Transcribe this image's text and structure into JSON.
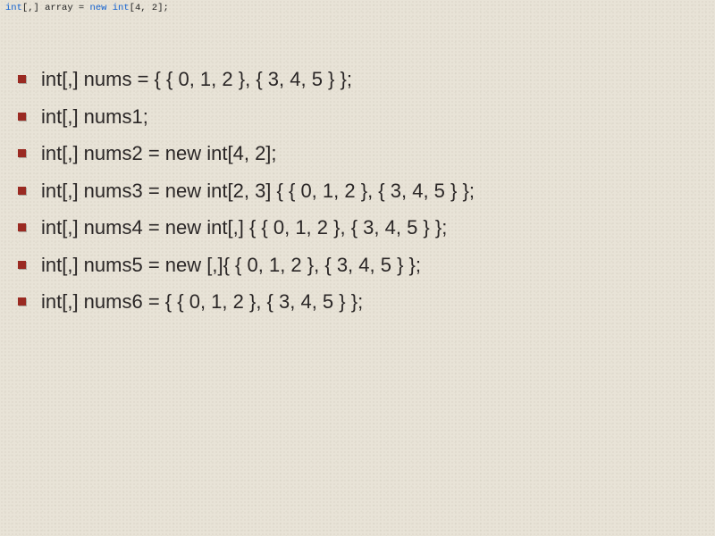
{
  "header": {
    "tokens": [
      {
        "t": "int",
        "cls": "kw-type"
      },
      {
        "t": "[,] array = ",
        "cls": "plain"
      },
      {
        "t": "new ",
        "cls": "kw-new"
      },
      {
        "t": "int",
        "cls": "kw-type"
      },
      {
        "t": "[",
        "cls": "plain"
      },
      {
        "t": "4",
        "cls": "num"
      },
      {
        "t": ", ",
        "cls": "plain"
      },
      {
        "t": "2",
        "cls": "num"
      },
      {
        "t": "];",
        "cls": "plain"
      }
    ]
  },
  "bullets": [
    "int[,] nums = { { 0, 1, 2 }, { 3, 4, 5 } };",
    "int[,] nums1;",
    "int[,] nums2 = new int[4, 2];",
    "int[,] nums3 = new int[2, 3] { { 0, 1, 2 }, { 3, 4, 5 } };",
    "int[,] nums4 = new int[,] { { 0, 1, 2 }, { 3, 4, 5 } };",
    "int[,] nums5 = new [,]{ { 0, 1, 2 }, { 3, 4, 5 } };",
    "int[,] nums6 = { { 0, 1, 2 }, { 3, 4, 5 } };"
  ]
}
